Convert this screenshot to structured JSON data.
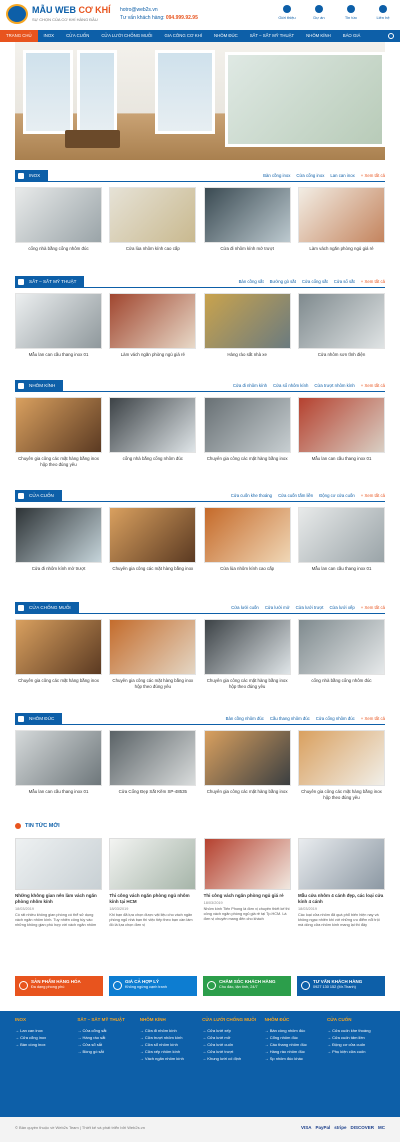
{
  "header": {
    "brand1": "MẪU WEB ",
    "brand2": "CƠ KHÍ",
    "tagline": "SỰ CHỌN CỦA CƠ KHÍ HÀNG ĐẦU",
    "email": "hotro@web2s.vn",
    "hotline_label": "Tư vấn khách hàng: ",
    "hotline": "094.999.92.95",
    "icons": [
      {
        "label": "Giới thiệu",
        "icon": "info-icon"
      },
      {
        "label": "Dự án",
        "icon": "project-icon"
      },
      {
        "label": "Tin tức",
        "icon": "news-icon"
      },
      {
        "label": "Liên hệ",
        "icon": "contact-icon"
      }
    ]
  },
  "nav": [
    "TRANG CHỦ",
    "INOX",
    "CỬA CUỐN",
    "CỬA LƯỚI CHỐNG MUỖI",
    "GIA CÔNG CƠ KHÍ",
    "NHÔM ĐÚC",
    "SẮT – SẮT MỸ THUẬT",
    "NHÔM KÍNH",
    "BÁO GIÁ"
  ],
  "sections": [
    {
      "title": "INOX",
      "links": [
        "Bàn cồng inox",
        "Cửa cổng inox",
        "Lan can inox"
      ],
      "all": "+ Xem tất cả",
      "items": [
        "cổng nhà bằng cổng nhôm đúc",
        "Cửa lùa nhôm kính cao cấp",
        "Cửa đi nhôm kính mở trượt",
        "Làm vách ngăn phòng ngủ giá rẻ"
      ]
    },
    {
      "title": "SẮT – SẮT MỸ THUẬT",
      "links": [
        "Bàn cồng sắt",
        "Bướng gò sắt",
        "Cửa cổng sắt",
        "Cửa sổ sắt"
      ],
      "all": "+ Xem tất cả",
      "items": [
        "Mẫu lan can cầu thang inox 01",
        "Làm vách ngăn phòng ngủ giá rẻ",
        "Hàng rào sắt nhà xe",
        "Cửa nhôm sơn tĩnh điện"
      ]
    },
    {
      "title": "NHÔM KÍNH",
      "links": [
        "Cửa đi nhôm kính",
        "Cửa sổ nhôm kính",
        "Cửa trượt nhôm kính"
      ],
      "all": "+ Xem tất cả",
      "items": [
        "Chuyên gia công các mặt hàng bằng inox hộp theo đúng yêu",
        "cổng nhà bằng cổng nhôm đúc",
        "Chuyên gia công các mặt hàng bằng inox",
        "Mẫu lan can cầu thang inox 01"
      ]
    },
    {
      "title": "CỬA CUỐN",
      "links": [
        "Cửa cuốn khe thoáng",
        "Cửa cuốn tấm liền",
        "Động cơ cửa cuốn"
      ],
      "all": "+ Xem tất cả",
      "items": [
        "Cửa đi nhôm kính mở trượt",
        "Chuyên gia công các mặt hàng bằng inox",
        "Cửa lùa nhôm kính cao cấp",
        "Mẫu lan can cầu thang inox 01"
      ]
    },
    {
      "title": "CỬA CHỐNG MUỖI",
      "links": [
        "Cửa lưới cuốn",
        "Cửa lưới mở",
        "Cửa lưới trượt",
        "Cửa lưới xếp"
      ],
      "all": "+ Xem tất cả",
      "items": [
        "Chuyên gia công các mặt hàng bằng inox",
        "Chuyên gia công các mặt hàng bằng inox hộp theo đúng yêu",
        "Chuyên gia công các mặt hàng bằng inox hộp theo đúng yêu",
        "cổng nhà bằng cổng nhôm đúc"
      ]
    },
    {
      "title": "NHÔM ĐÚC",
      "links": [
        "Bàn cồng nhôm đúc",
        "Cầu thang nhôm đúc",
        "Cửa cổng nhôm đúc"
      ],
      "all": "+ Xem tất cả",
      "items": [
        "Mẫu lan can cầu thang inox 01",
        "Cửa Cổng Đẹp Sắt Kẽm SP-48535",
        "Chuyên gia công các mặt hàng bằng inox",
        "Chuyên gia công các mặt hàng bằng inox hộp theo đúng yêu"
      ]
    }
  ],
  "news": {
    "title": "TIN TỨC MỚI",
    "items": [
      {
        "t": "Những không gian nên làm vách ngăn phòng nhôm kính",
        "d": "18/03/2019",
        "s": "Có rất nhiều không gian phòng có thể sử dụng vách ngăn nhôm kính. Tuy nhiên công tùy vào những không gian phù hợp với vách ngăn nhôm"
      },
      {
        "t": "Thi công vách ngăn phòng ngủ nhôm kính tại HCM",
        "d": "18/03/2019",
        "s": "Khi bạn đã lựa chọn được vật liệu cho vách ngăn phòng ngủ nhà bạn thì việc tiếp theo bạn cần làm đó là lựa chọn đơn vị"
      },
      {
        "t": "Thi công vách ngăn phòng ngủ giá rẻ",
        "d": "18/03/2019",
        "s": "Nhôm kính Tiến Phong là đơn vị chuyên thiết kế thi công vách ngăn phòng ngủ giá rẻ tại Tp.HCM. Là đơn vị chuyên mang đến cho khách"
      },
      {
        "t": "Mẫu cửa nhôm 4 cánh đẹp, các loại cửa kính 4 cánh",
        "d": "18/03/2019",
        "s": "Các loại cửa nhôm đã quá phổ biến hiện nay và không ngạc nhiên khi với những ưu điểm nổi trội mà dòng cửa nhôm kính mang lại thì đây"
      }
    ]
  },
  "services": [
    {
      "b": "SẢN PHẨM HÀNG HÓA",
      "s": "Đa dạng phong phú",
      "color": "#e8541e"
    },
    {
      "b": "GIÁ CẢ HỢP LÝ",
      "s": "Không ngừng cạnh tranh",
      "color": "#0d7dd1"
    },
    {
      "b": "CHĂM SÓC KHÁCH HÀNG",
      "s": "Chu đáo, tận tình, 24/7",
      "color": "#2c9e4b"
    },
    {
      "b": "TƯ VẤN KHÁCH HÀNG",
      "s": "0927 130 152 (Mr.Thanh)",
      "color": "#0d5fa8"
    }
  ],
  "footer": [
    {
      "h": "INOX",
      "items": [
        "Lan can inox",
        "Cửa cổng inox",
        "Bàn cồng inox"
      ]
    },
    {
      "h": "SẮT – SẮT MỸ THUẬT",
      "items": [
        "Cửa cổng sắt",
        "Hàng rào sắt",
        "Cửa sổ sắt",
        "Bồng gò sắt"
      ]
    },
    {
      "h": "NHÔM KÍNH",
      "items": [
        "Cửa đi nhôm kính",
        "Cửa trượt nhôm kính",
        "Cửa sổ nhôm kính",
        "Cửa xếp nhôm kính",
        "Vách ngăn nhôm kính"
      ]
    },
    {
      "h": "CỬA LƯỚI CHỐNG MUỖI",
      "items": [
        "Cửa lưới xếp",
        "Cửa lưới mở",
        "Cửa lưới cuốn",
        "Cửa lưới trượt",
        "Khung lưới cố định"
      ]
    },
    {
      "h": "NHÔM ĐÚC",
      "items": [
        "Bàn cồng nhôm đúc",
        "Cổng nhôm đúc",
        "Cầu thang nhôm đúc",
        "Hàng rào nhôm đúc",
        "Sp nhôm đúc khác"
      ]
    },
    {
      "h": "CỬA CUỐN",
      "items": [
        "Cửa cuốn khe thoáng",
        "Cửa cuốn tấm liền",
        "Động cơ cửa cuốn",
        "Phụ kiện cửa cuốn"
      ]
    }
  ],
  "copyright": "© Bản quyền thuộc về Web2s Team | Thiết kế và phát triển bởi Web2s.vn",
  "payments": [
    "VISA",
    "PayPal",
    "stripe",
    "DISCOVER",
    "MC"
  ]
}
